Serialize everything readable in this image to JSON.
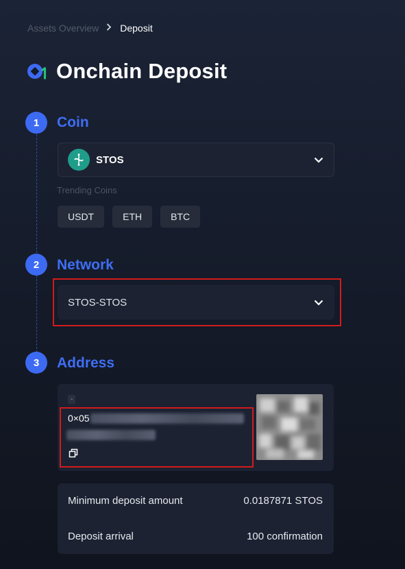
{
  "breadcrumb": {
    "parent": "Assets Overview",
    "current": "Deposit"
  },
  "page": {
    "title": "Onchain Deposit"
  },
  "steps": [
    {
      "number": "1",
      "title": "Coin"
    },
    {
      "number": "2",
      "title": "Network"
    },
    {
      "number": "3",
      "title": "Address"
    }
  ],
  "coin": {
    "selected": "STOS",
    "trending_label": "Trending Coins",
    "trending": [
      "USDT",
      "ETH",
      "BTC"
    ]
  },
  "network": {
    "selected": "STOS-STOS"
  },
  "address": {
    "tag": "-",
    "prefix": "0×05"
  },
  "info": {
    "min_deposit_label": "Minimum deposit amount",
    "min_deposit_value": "0.0187871 STOS",
    "arrival_label": "Deposit arrival",
    "arrival_value": "100 confirmation"
  },
  "colors": {
    "accent": "#3d6af2",
    "highlight": "#d31b1b",
    "coin_icon": "#1f9d8a",
    "background": "#161c2a"
  }
}
